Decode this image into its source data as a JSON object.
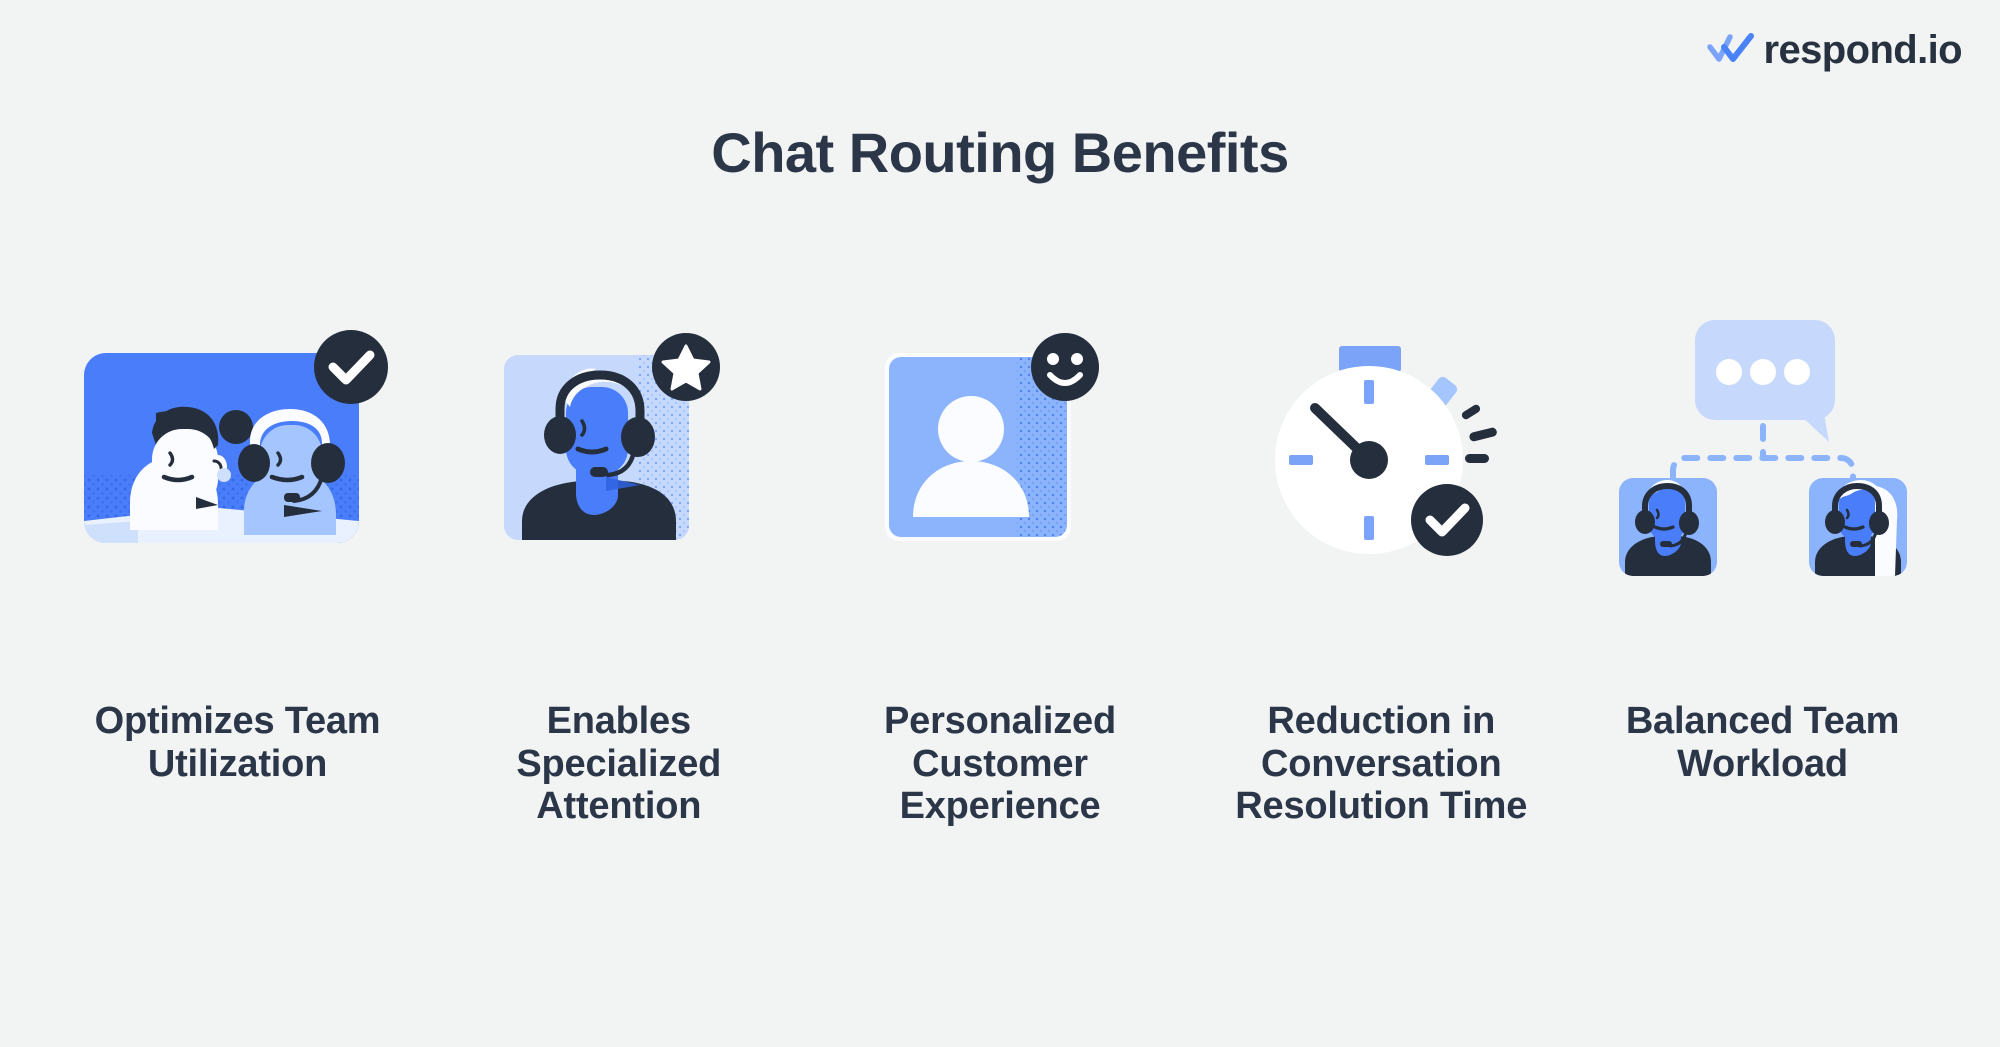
{
  "page": {
    "background_color": "#f2f3f3",
    "title": "Chat Routing Benefits"
  },
  "brand": {
    "name": "respond.io",
    "logo_icon": "double-check-icon",
    "logo_color": "#4a82f7",
    "text_color": "#27313f"
  },
  "palette": {
    "accent_blue": "#4a7dfa",
    "mid_blue": "#8cb4fc",
    "light_blue": "#c6d9fd",
    "pale_blue": "#e2ecfe",
    "dark_navy": "#242e3d",
    "text_navy": "#2b3648",
    "white": "#ffffff"
  },
  "benefits": [
    {
      "id": "optimizes-team-utilization",
      "label": "Optimizes Team Utilization",
      "illustration": "two-agents-card",
      "badge_icon": "check-badge-icon",
      "card_color": "#4a7dfa"
    },
    {
      "id": "enables-specialized-attention",
      "label": "Enables Specialized Attention",
      "illustration": "headset-agent-card",
      "badge_icon": "star-badge-icon",
      "card_color": "#c6d9fd"
    },
    {
      "id": "personalized-customer-experience",
      "label": "Personalized Customer Experience",
      "illustration": "customer-avatar-card",
      "badge_icon": "smiley-badge-icon",
      "card_color": "#8cb4fc"
    },
    {
      "id": "reduction-in-conversation-resolution-time",
      "label": "Reduction in Conversation Resolution Time",
      "illustration": "stopwatch",
      "badge_icon": "check-badge-icon",
      "card_color": "#ffffff"
    },
    {
      "id": "balanced-team-workload",
      "label": "Balanced Team Workload",
      "illustration": "chat-routing-to-two-agents",
      "badge_icon": "none",
      "card_color": "#8cb4fc"
    }
  ]
}
